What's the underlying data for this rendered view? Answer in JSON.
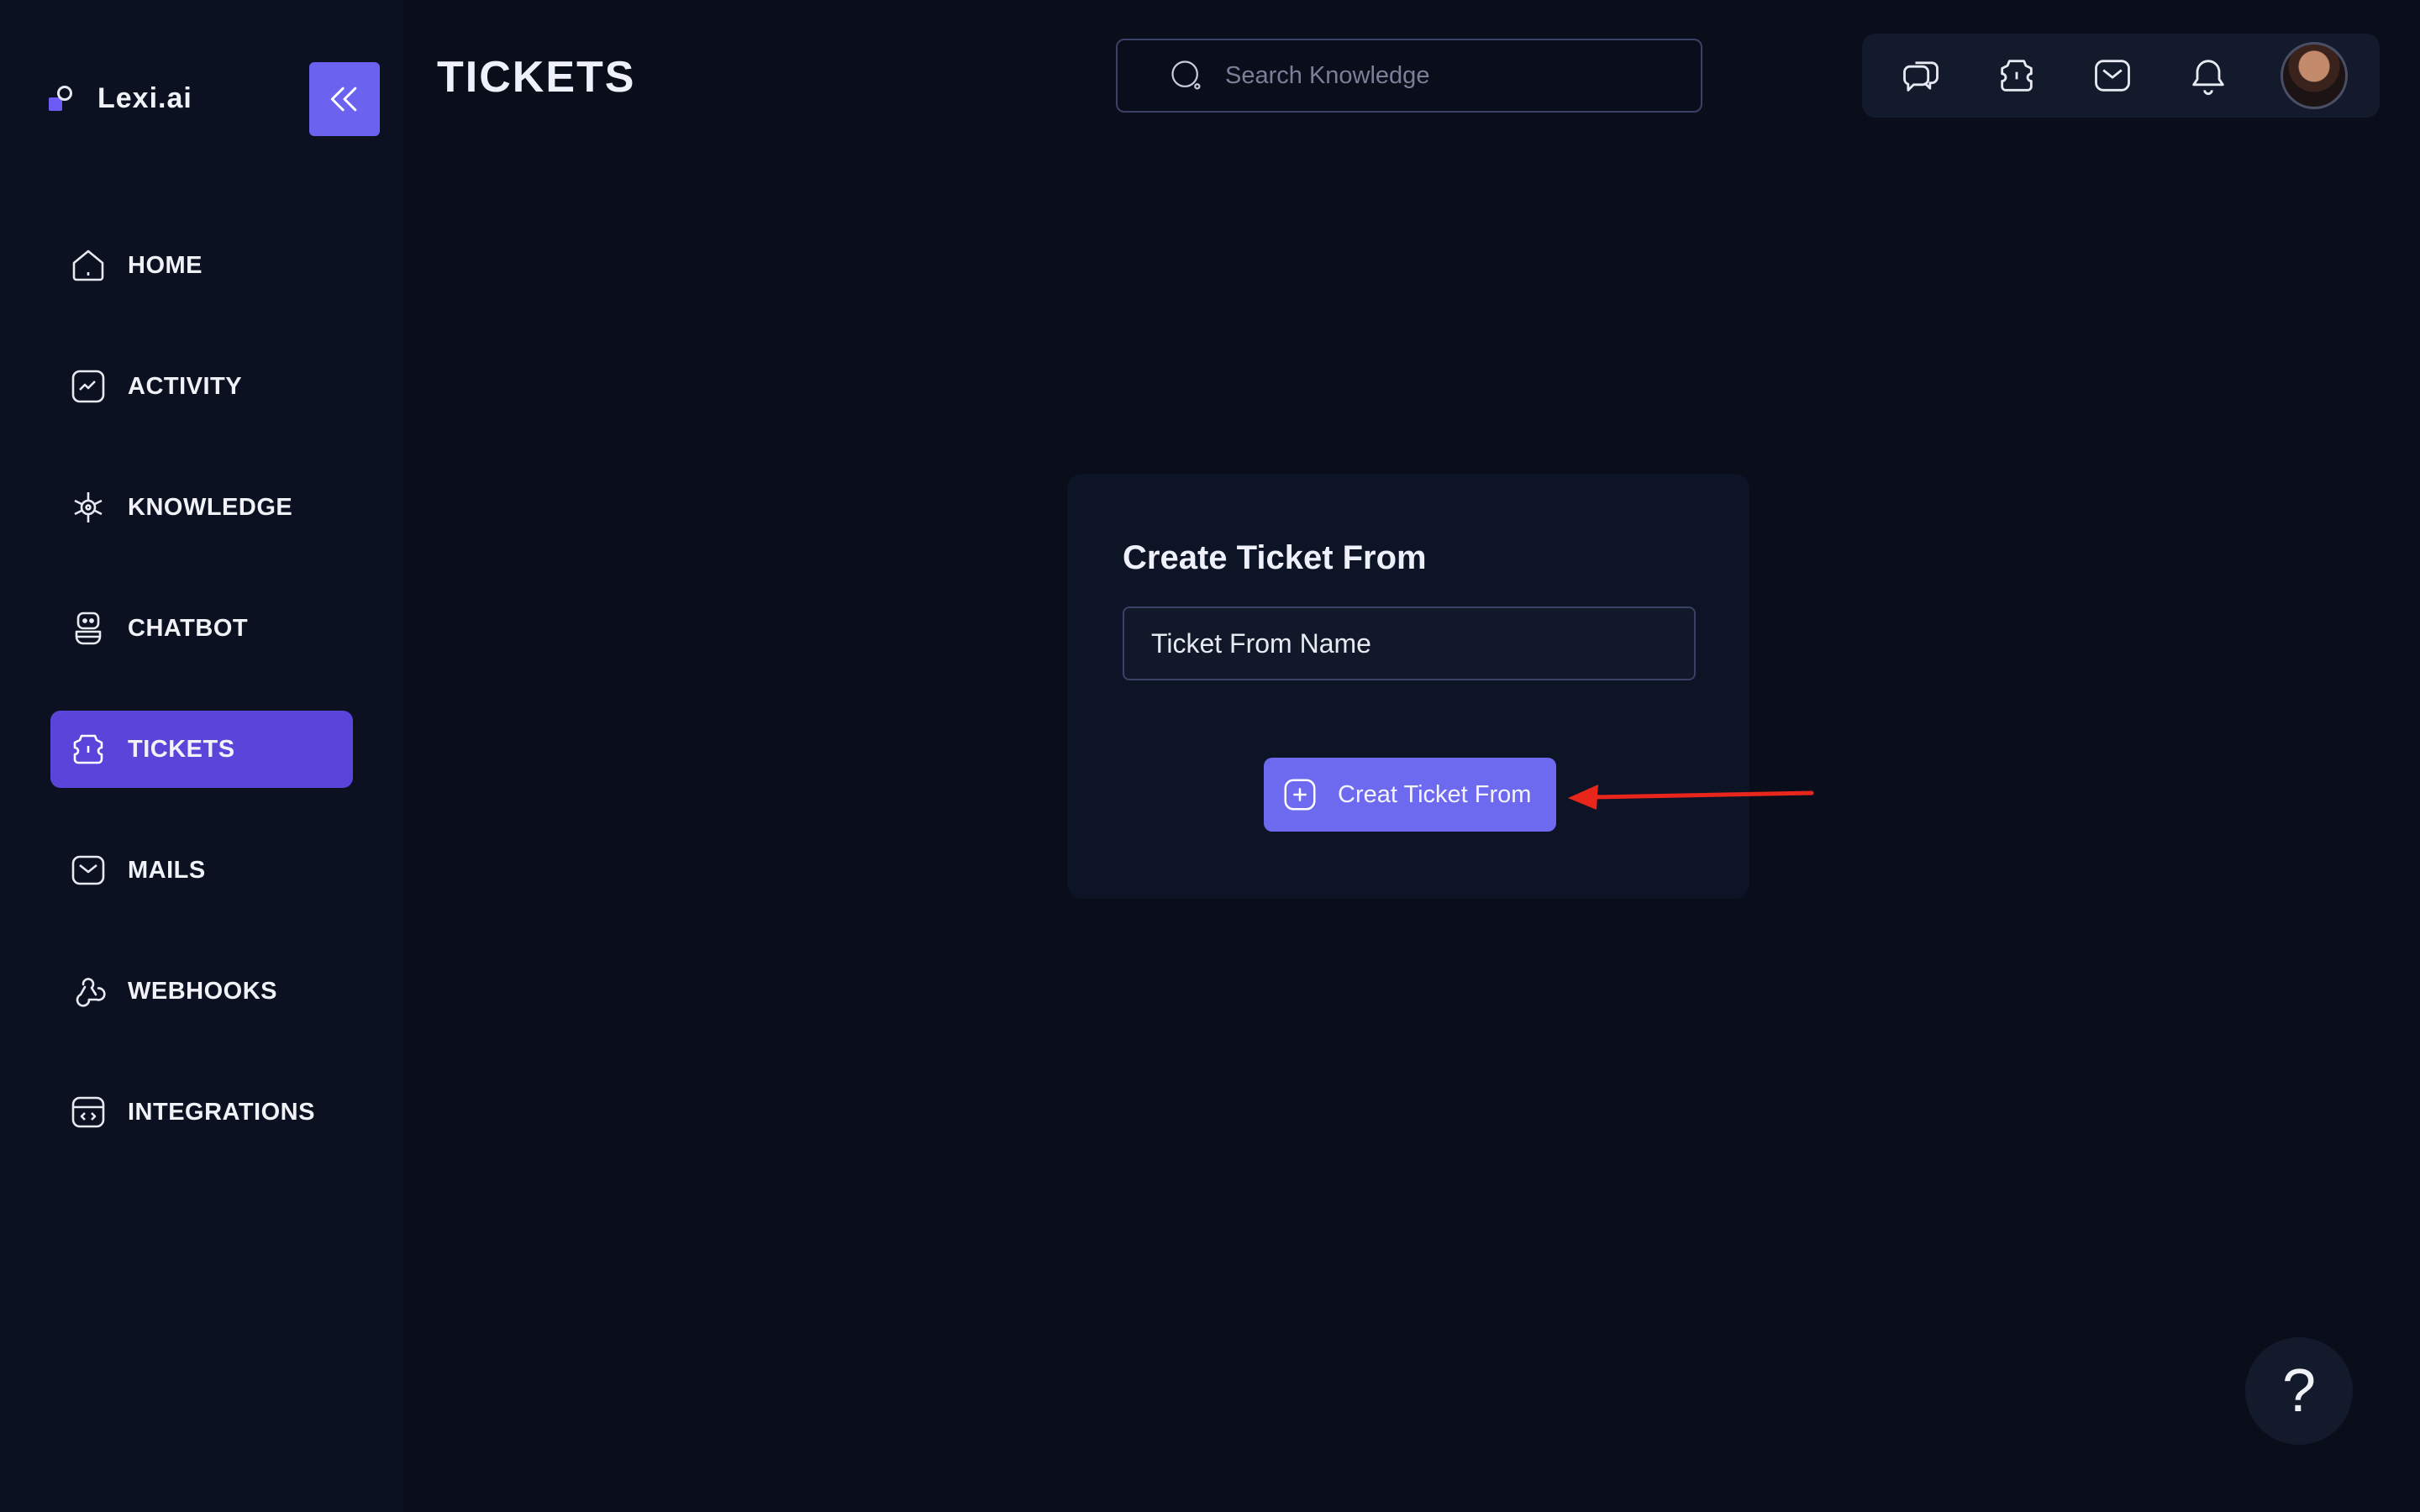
{
  "app": {
    "name": "Lexi.ai"
  },
  "header": {
    "title": "TICKETS",
    "search_placeholder": "Search Knowledge"
  },
  "sidebar": {
    "items": [
      {
        "label": "HOME",
        "icon": "home-icon",
        "active": false
      },
      {
        "label": "ACTIVITY",
        "icon": "activity-icon",
        "active": false
      },
      {
        "label": "KNOWLEDGE",
        "icon": "knowledge-icon",
        "active": false
      },
      {
        "label": "CHATBOT",
        "icon": "robot-icon",
        "active": false
      },
      {
        "label": "TICKETS",
        "icon": "ticket-icon",
        "active": true
      },
      {
        "label": "MAILS",
        "icon": "mail-icon",
        "active": false
      },
      {
        "label": "WEBHOOKS",
        "icon": "webhook-icon",
        "active": false
      },
      {
        "label": "INTEGRATIONS",
        "icon": "code-icon",
        "active": false
      }
    ]
  },
  "topbar": {
    "icons": [
      "chat-icon",
      "ticket-icon",
      "mail-icon",
      "bell-icon",
      "avatar"
    ]
  },
  "card": {
    "title": "Create Ticket From",
    "input_placeholder": "Ticket From Name",
    "button_label": "Creat Ticket From"
  },
  "help": {
    "label": "?"
  },
  "colors": {
    "background": "#0a0e1a",
    "sidebar": "#0b1120",
    "accent": "#6e6af0",
    "active_nav": "#5945d9",
    "annotation_arrow": "#e8261c"
  }
}
